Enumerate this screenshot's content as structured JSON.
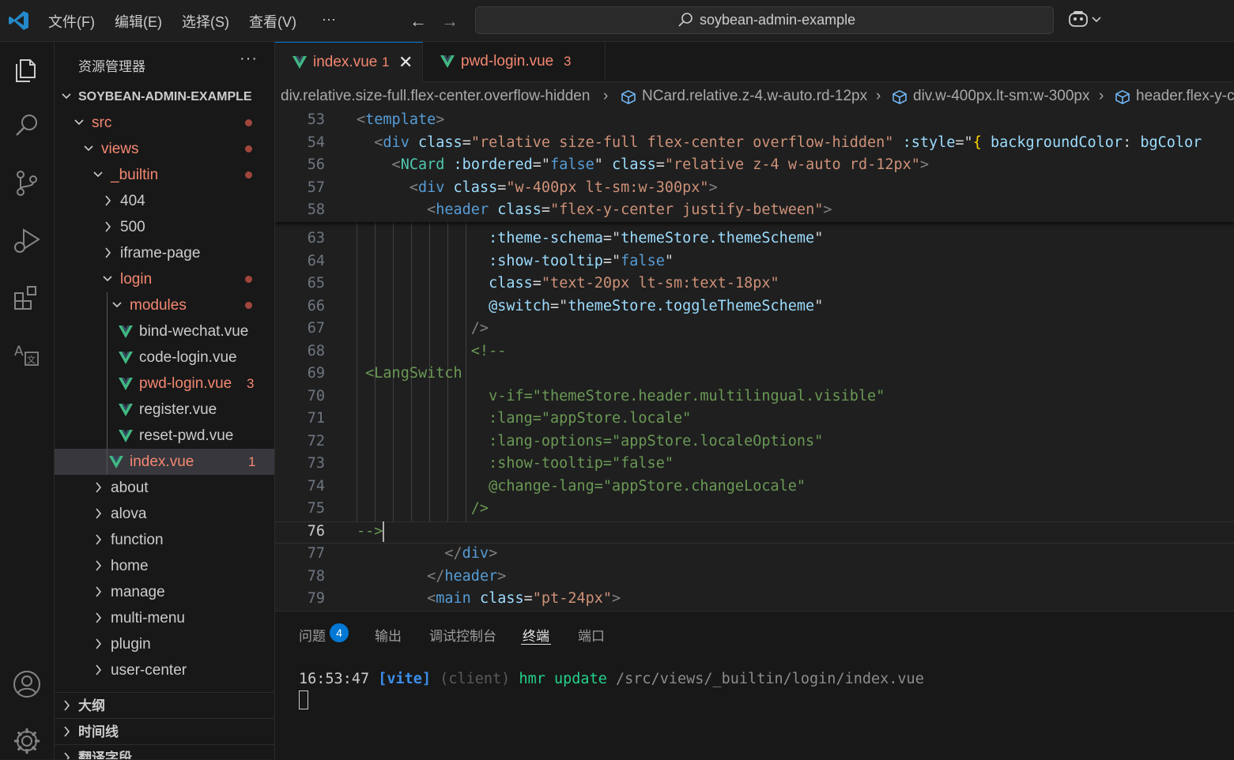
{
  "titlebar": {
    "menus": [
      "文件(F)",
      "编辑(E)",
      "选择(S)",
      "查看(V)",
      "···"
    ],
    "search_text": "soybean-admin-example"
  },
  "sidebar": {
    "title": "资源管理器",
    "more": "···",
    "root": "SOYBEAN-ADMIN-EXAMPLE",
    "tree": [
      {
        "label": "src",
        "modified": true
      },
      {
        "label": "views",
        "modified": true
      },
      {
        "label": "_builtin",
        "modified": true
      },
      {
        "label": "404"
      },
      {
        "label": "500"
      },
      {
        "label": "iframe-page"
      },
      {
        "label": "login",
        "modified": true
      },
      {
        "label": "modules",
        "modified": true
      },
      {
        "label": "bind-wechat.vue"
      },
      {
        "label": "code-login.vue"
      },
      {
        "label": "pwd-login.vue",
        "badge": "3"
      },
      {
        "label": "register.vue"
      },
      {
        "label": "reset-pwd.vue"
      },
      {
        "label": "index.vue",
        "badge": "1",
        "selected": true
      },
      {
        "label": "about"
      },
      {
        "label": "alova"
      },
      {
        "label": "function"
      },
      {
        "label": "home"
      },
      {
        "label": "manage"
      },
      {
        "label": "multi-menu"
      },
      {
        "label": "plugin"
      },
      {
        "label": "user-center"
      }
    ],
    "sections": [
      "大纲",
      "时间线",
      "翻译字段"
    ]
  },
  "tabs": [
    {
      "label": "index.vue",
      "badge": "1",
      "active": true
    },
    {
      "label": "pwd-login.vue",
      "badge": "3",
      "active": false
    }
  ],
  "breadcrumbs": [
    "div.relative.size-full.flex-center.overflow-hidden",
    "NCard.relative.z-4.w-auto.rd-12px",
    "div.w-400px.lt-sm:w-300px",
    "header.flex-y-c"
  ],
  "editor": {
    "sticky_lines": [
      {
        "num": "53",
        "tokens": [
          [
            "c-br",
            "<"
          ],
          [
            "c-tag",
            "template"
          ],
          [
            "c-br",
            ">"
          ]
        ]
      },
      {
        "num": "54",
        "tokens": [
          [
            "c-br",
            "  <"
          ],
          [
            "c-tag",
            "div"
          ],
          [
            "c-eq",
            " "
          ],
          [
            "c-attr",
            "class"
          ],
          [
            "c-eq",
            "="
          ],
          [
            "c-str",
            "\"relative size-full flex-center overflow-hidden\""
          ],
          [
            "c-eq",
            " "
          ],
          [
            "c-attr",
            ":style"
          ],
          [
            "c-eq",
            "=\""
          ],
          [
            "c-bold",
            "{"
          ],
          [
            "c-attr",
            " backgroundColor"
          ],
          [
            "c-eq",
            ": "
          ],
          [
            "c-attr",
            "bgColor"
          ]
        ]
      },
      {
        "num": "56",
        "tokens": [
          [
            "c-br",
            "    <"
          ],
          [
            "c-comp",
            "NCard"
          ],
          [
            "c-eq",
            " "
          ],
          [
            "c-attr",
            ":bordered"
          ],
          [
            "c-eq",
            "=\""
          ],
          [
            "c-tag",
            "false"
          ],
          [
            "c-eq",
            "\" "
          ],
          [
            "c-attr",
            "class"
          ],
          [
            "c-eq",
            "="
          ],
          [
            "c-str",
            "\"relative z-4 w-auto rd-12px\""
          ],
          [
            "c-br",
            ">"
          ]
        ]
      },
      {
        "num": "57",
        "tokens": [
          [
            "c-br",
            "      <"
          ],
          [
            "c-tag",
            "div"
          ],
          [
            "c-eq",
            " "
          ],
          [
            "c-attr",
            "class"
          ],
          [
            "c-eq",
            "="
          ],
          [
            "c-str",
            "\"w-400px lt-sm:w-300px\""
          ],
          [
            "c-br",
            ">"
          ]
        ]
      },
      {
        "num": "58",
        "tokens": [
          [
            "c-br",
            "        <"
          ],
          [
            "c-tag",
            "header"
          ],
          [
            "c-eq",
            " "
          ],
          [
            "c-attr",
            "class"
          ],
          [
            "c-eq",
            "="
          ],
          [
            "c-str",
            "\"flex-y-center justify-between\""
          ],
          [
            "c-br",
            ">"
          ]
        ]
      }
    ],
    "lines": [
      {
        "num": "63",
        "tokens": [
          [
            "c-eq",
            "               "
          ],
          [
            "c-attr",
            ":theme-schema"
          ],
          [
            "c-eq",
            "=\""
          ],
          [
            "c-attr",
            "themeStore.themeScheme"
          ],
          [
            "c-eq",
            "\""
          ]
        ]
      },
      {
        "num": "64",
        "tokens": [
          [
            "c-eq",
            "               "
          ],
          [
            "c-attr",
            ":show-tooltip"
          ],
          [
            "c-eq",
            "=\""
          ],
          [
            "c-tag",
            "false"
          ],
          [
            "c-eq",
            "\""
          ]
        ]
      },
      {
        "num": "65",
        "tokens": [
          [
            "c-eq",
            "               "
          ],
          [
            "c-attr",
            "class"
          ],
          [
            "c-eq",
            "="
          ],
          [
            "c-str",
            "\"text-20px lt-sm:text-18px\""
          ]
        ]
      },
      {
        "num": "66",
        "tokens": [
          [
            "c-eq",
            "               "
          ],
          [
            "c-attr",
            "@switch"
          ],
          [
            "c-eq",
            "=\""
          ],
          [
            "c-attr",
            "themeStore.toggleThemeScheme"
          ],
          [
            "c-eq",
            "\""
          ]
        ]
      },
      {
        "num": "67",
        "tokens": [
          [
            "c-br",
            "             />"
          ]
        ]
      },
      {
        "num": "68",
        "tokens": [
          [
            "c-cm",
            "             <!--"
          ]
        ]
      },
      {
        "num": "69",
        "tokens": [
          [
            "c-cm",
            " <LangSwitch"
          ]
        ]
      },
      {
        "num": "70",
        "tokens": [
          [
            "c-cm",
            "               v-if=\"themeStore.header.multilingual.visible\""
          ]
        ]
      },
      {
        "num": "71",
        "tokens": [
          [
            "c-cm",
            "               :lang=\"appStore.locale\""
          ]
        ]
      },
      {
        "num": "72",
        "tokens": [
          [
            "c-cm",
            "               :lang-options=\"appStore.localeOptions\""
          ]
        ]
      },
      {
        "num": "73",
        "tokens": [
          [
            "c-cm",
            "               :show-tooltip=\"false\""
          ]
        ]
      },
      {
        "num": "74",
        "tokens": [
          [
            "c-cm",
            "               @change-lang=\"appStore.changeLocale\""
          ]
        ]
      },
      {
        "num": "75",
        "tokens": [
          [
            "c-cm",
            "             />"
          ]
        ]
      },
      {
        "num": "76",
        "tokens": [
          [
            "c-cm",
            "-->"
          ]
        ],
        "current": true
      },
      {
        "num": "77",
        "tokens": [
          [
            "c-br",
            "          </"
          ],
          [
            "c-tag",
            "div"
          ],
          [
            "c-br",
            ">"
          ]
        ]
      },
      {
        "num": "78",
        "tokens": [
          [
            "c-br",
            "        </"
          ],
          [
            "c-tag",
            "header"
          ],
          [
            "c-br",
            ">"
          ]
        ]
      },
      {
        "num": "79",
        "tokens": [
          [
            "c-br",
            "        <"
          ],
          [
            "c-tag",
            "main"
          ],
          [
            "c-eq",
            " "
          ],
          [
            "c-attr",
            "class"
          ],
          [
            "c-eq",
            "="
          ],
          [
            "c-str",
            "\"pt-24px\""
          ],
          [
            "c-br",
            ">"
          ]
        ]
      }
    ]
  },
  "panel": {
    "tabs": [
      "问题",
      "输出",
      "调试控制台",
      "终端",
      "端口"
    ],
    "active_tab": "终端",
    "problem_count": "4",
    "terminal": {
      "time": "16:53:47",
      "tag": "[vite]",
      "client": "(client)",
      "action": "hmr update",
      "path": "/src/views/_builtin/login/index.vue"
    }
  },
  "colors": {
    "accent": "#0078d4",
    "modified": "#f48771",
    "vue_green": "#41b883"
  }
}
